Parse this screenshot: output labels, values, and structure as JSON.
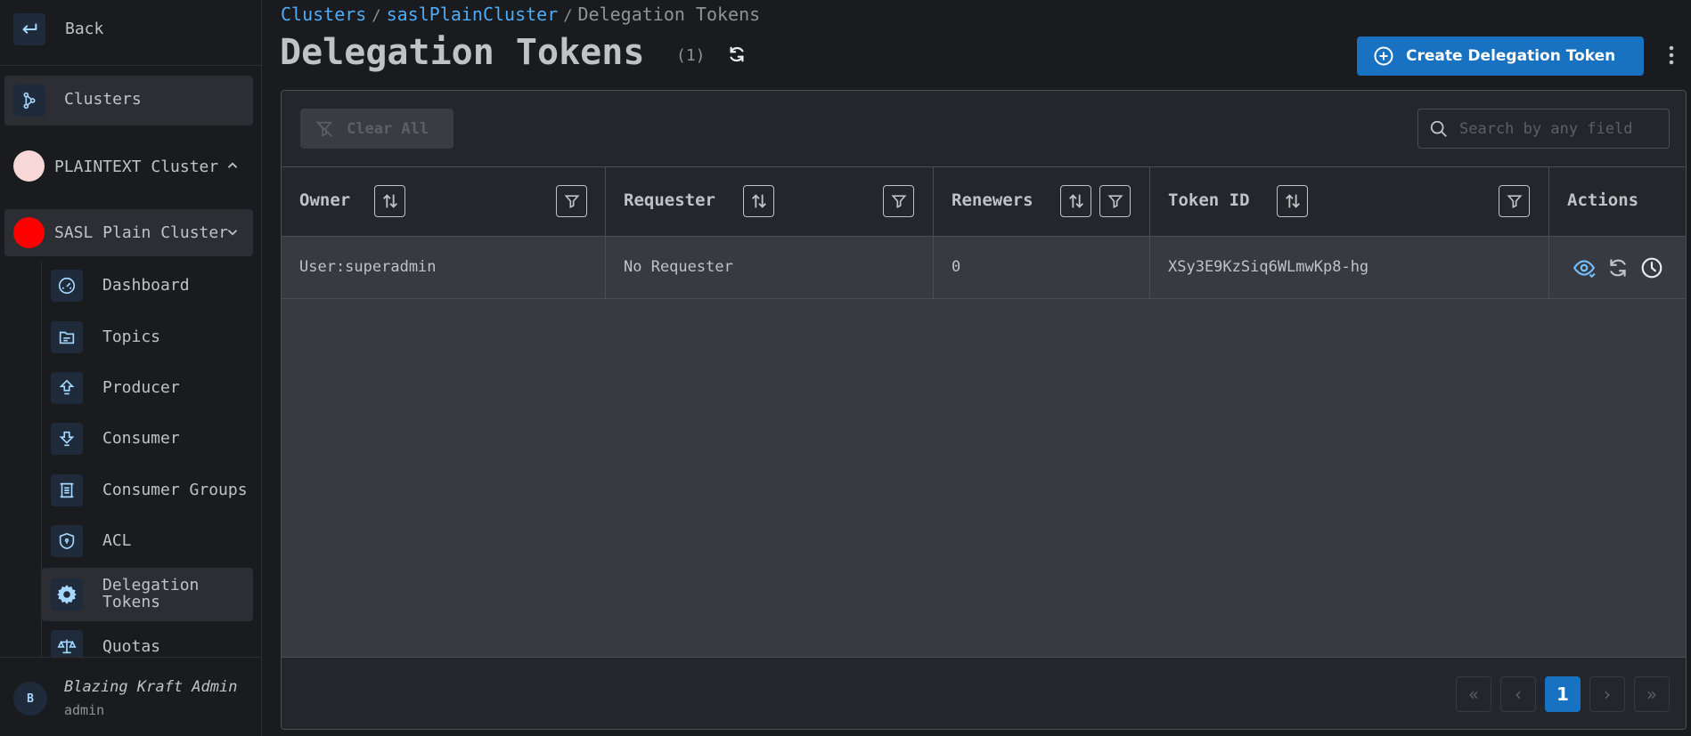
{
  "sidebar": {
    "back_label": "Back",
    "clusters_label": "Clusters",
    "clusters": [
      {
        "label": "PLAINTEXT Cluster",
        "color": "#f8d7d7"
      },
      {
        "label": "SASL Plain Cluster",
        "color": "#ff0000"
      }
    ],
    "sub_items": [
      {
        "label": "Dashboard",
        "icon": "dashboard-gauge-icon"
      },
      {
        "label": "Topics",
        "icon": "topics-icon"
      },
      {
        "label": "Producer",
        "icon": "producer-upload-icon"
      },
      {
        "label": "Consumer",
        "icon": "consumer-download-icon"
      },
      {
        "label": "Consumer Groups",
        "icon": "consumer-groups-icon"
      },
      {
        "label": "ACL",
        "icon": "shield-icon"
      },
      {
        "label": "Delegation Tokens",
        "icon": "gear-badge-icon"
      },
      {
        "label": "Quotas",
        "icon": "scale-icon"
      }
    ],
    "user": {
      "initial": "B",
      "name": "Blazing Kraft Admin",
      "role": "admin"
    }
  },
  "breadcrumb": {
    "clusters": "Clusters",
    "cluster": "saslPlainCluster",
    "current": "Delegation Tokens"
  },
  "header": {
    "title": "Delegation Tokens",
    "count": "(1)",
    "create_label": "Create Delegation Token"
  },
  "toolbar": {
    "clear_label": "Clear All",
    "search_placeholder": "Search by any field"
  },
  "table": {
    "columns": [
      "Owner",
      "Requester",
      "Renewers",
      "Token ID",
      "Actions"
    ],
    "rows": [
      {
        "owner": "User:superadmin",
        "requester": "No Requester",
        "renewers": "0",
        "token_id": "XSy3E9KzSiq6WLmwKp8-hg"
      }
    ]
  },
  "pagination": {
    "first": "«",
    "prev": "‹",
    "current": "1",
    "next": "›",
    "last": "»"
  },
  "colors": {
    "accent": "#1971c2",
    "link": "#4dabf7",
    "icon": "#a5d8ff"
  }
}
